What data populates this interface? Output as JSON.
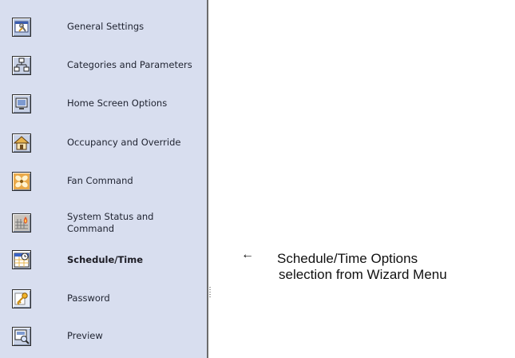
{
  "menu": {
    "items": [
      {
        "label": "General Settings",
        "icon": "wrench-settings-icon"
      },
      {
        "label": "Categories and Parameters",
        "icon": "hierarchy-icon"
      },
      {
        "label": "Home Screen Options",
        "icon": "home-screen-icon"
      },
      {
        "label": "Occupancy and Override",
        "icon": "house-icon"
      },
      {
        "label": "Fan Command",
        "icon": "fan-icon"
      },
      {
        "label": "System Status and Command",
        "icon": "system-status-icon"
      },
      {
        "label": "Schedule/Time",
        "icon": "calendar-clock-icon",
        "selected": true
      },
      {
        "label": "Password",
        "icon": "key-icon"
      },
      {
        "label": "Preview",
        "icon": "preview-icon"
      }
    ]
  },
  "callout": {
    "arrow": "←",
    "line1": "Schedule/Time Options",
    "line2": "selection from Wizard Menu"
  },
  "colors": {
    "menu_background": "#d8deef",
    "menu_border": "#6c6c6c",
    "label_text": "#1f2330"
  }
}
